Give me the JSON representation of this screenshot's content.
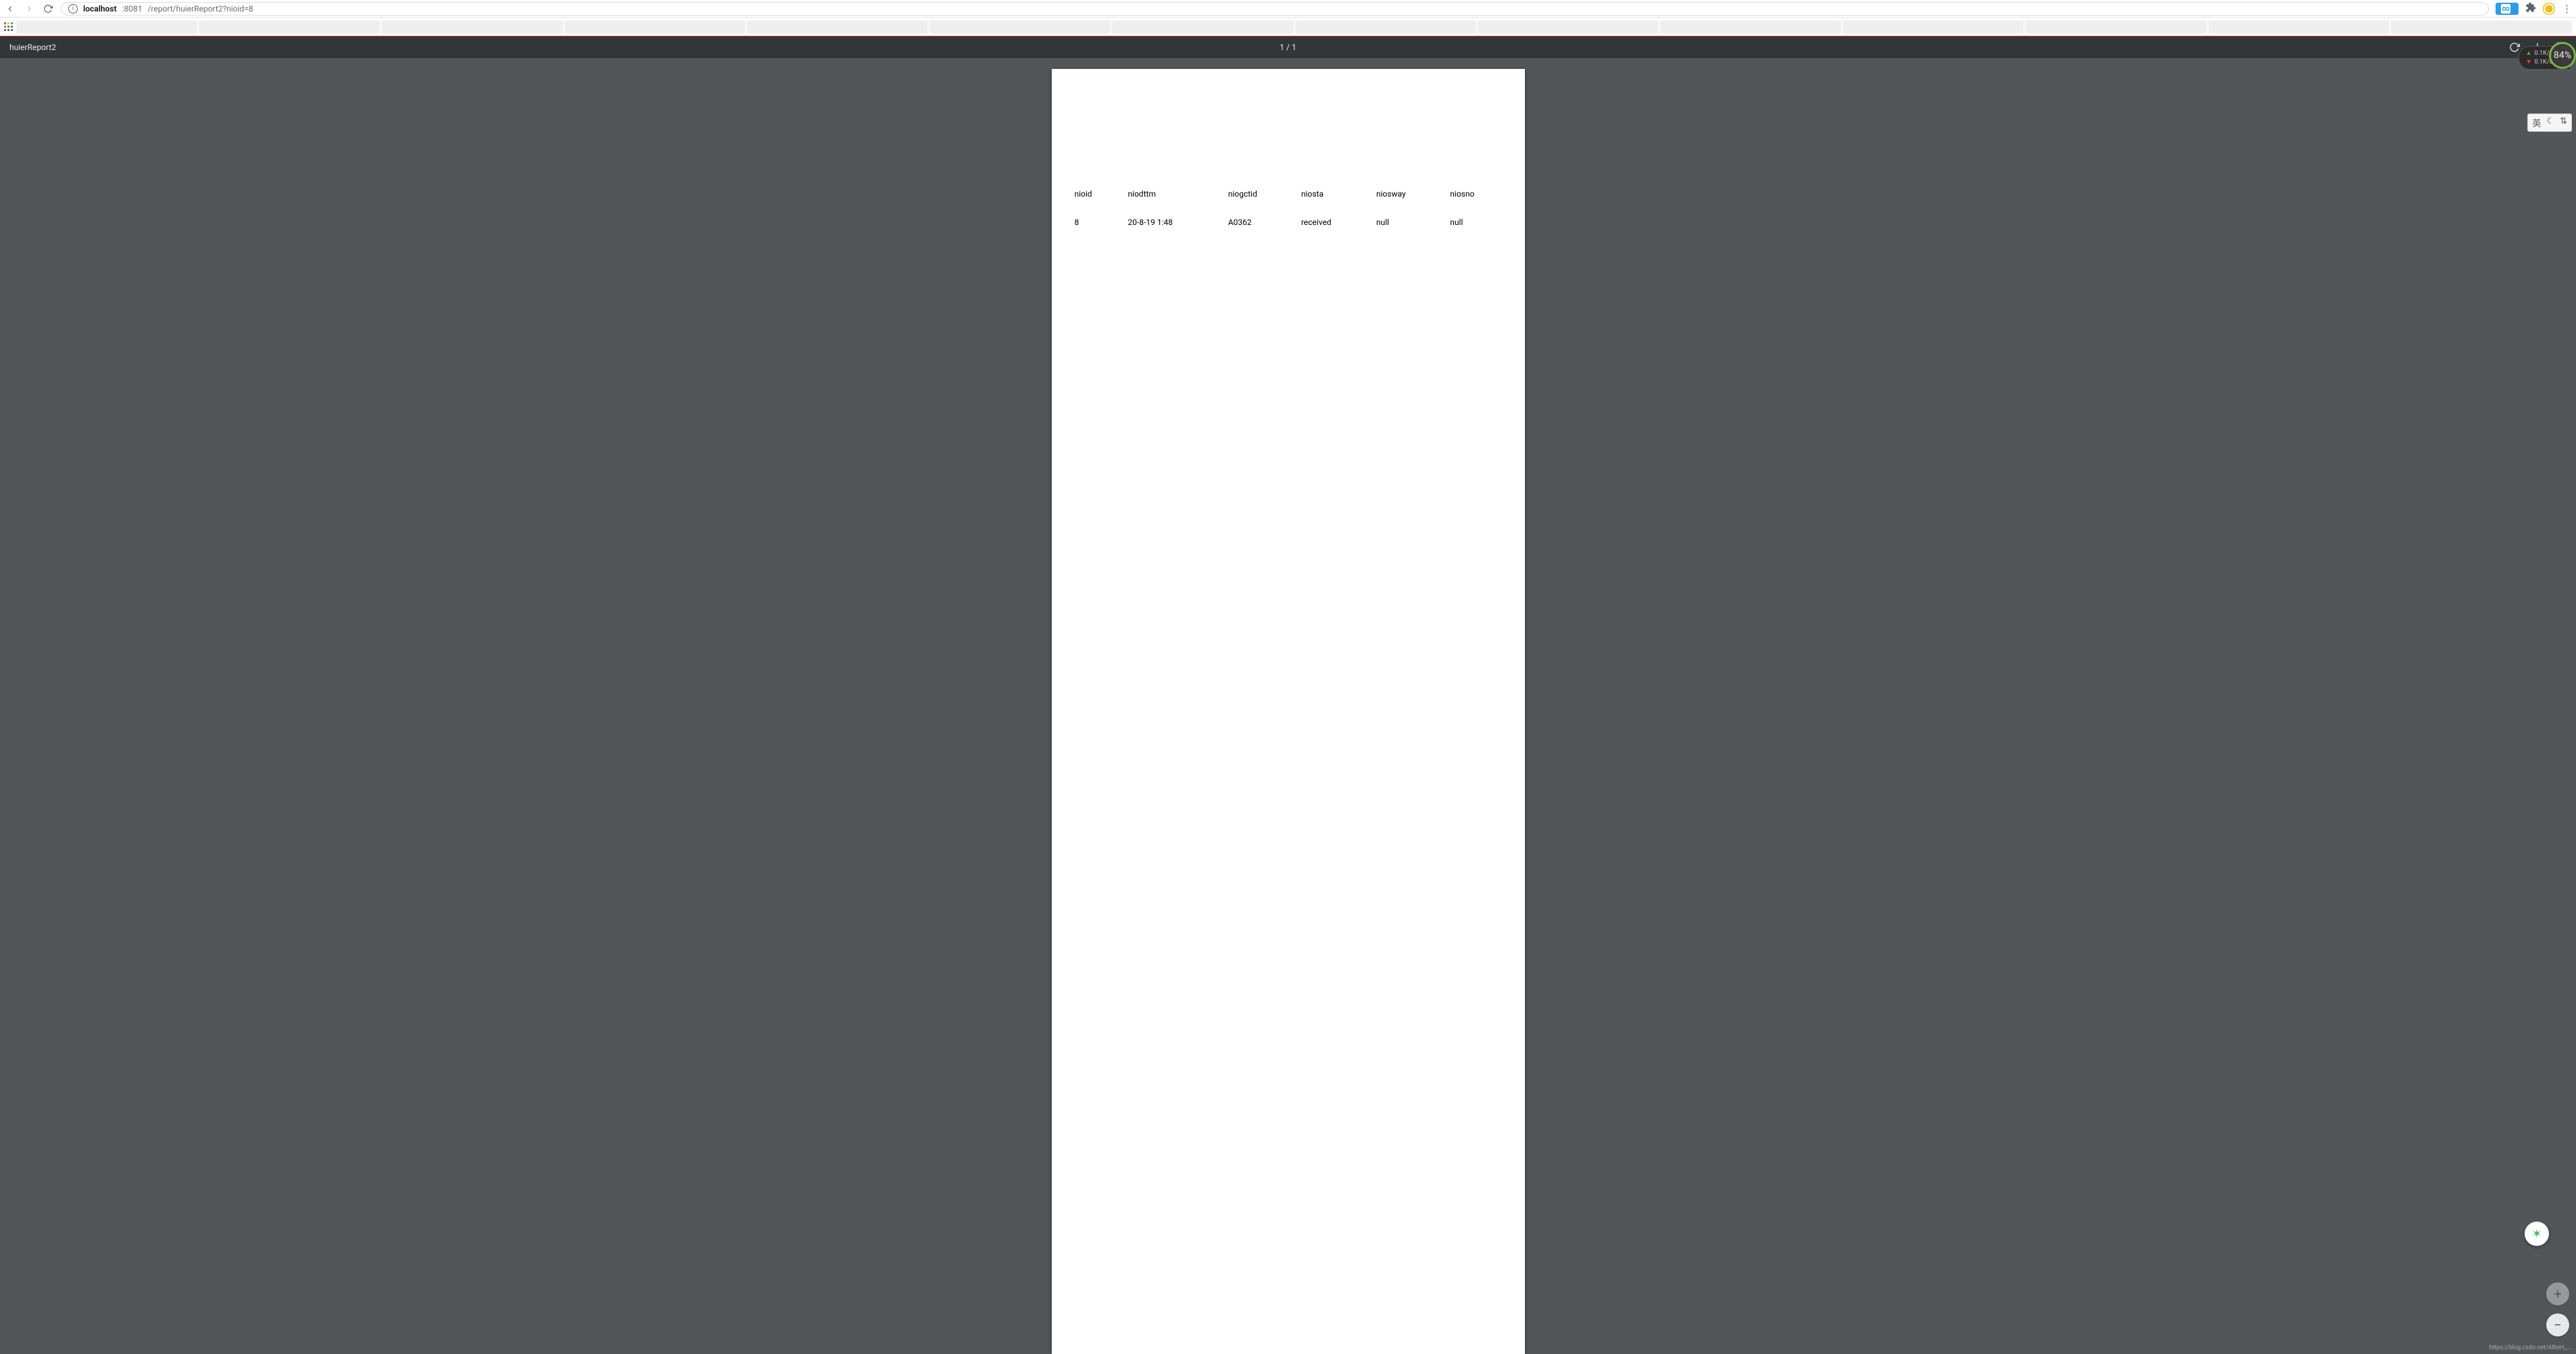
{
  "browser": {
    "url_host": "localhost",
    "url_port": ":8081",
    "url_path": "/report/huierReport2?nioid=8",
    "extension_label": ""
  },
  "pdfViewer": {
    "title": "huierReport2",
    "page_indicator": "1 / 1"
  },
  "report": {
    "headers": [
      "nioid",
      "niodttm",
      "niogctid",
      "niosta",
      "niosway",
      "niosno"
    ],
    "row": {
      "nioid": "8",
      "niodttm": "20-8-19 1:48",
      "niogctid": "A0362",
      "niosta": "received",
      "niosway": "null",
      "niosno": "null"
    }
  },
  "widgets": {
    "net_up": "0.1K/s",
    "net_down": "0.1K/s",
    "percent": "84%",
    "watermark": "https://blog.csdn.net/Albert_..."
  },
  "zoom": {
    "plus": "+",
    "minus": "−"
  }
}
